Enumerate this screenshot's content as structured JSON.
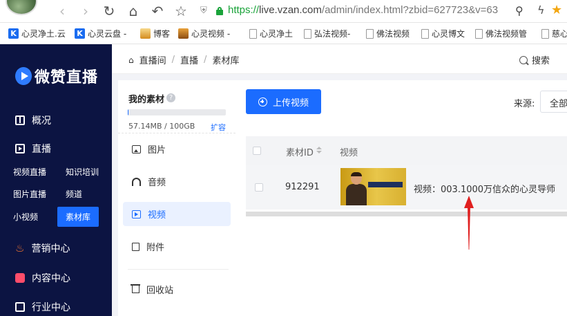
{
  "browser": {
    "url_protocol": "https://",
    "url_host": "live.vzan.com",
    "url_path": "/admin/index.html?zbid=627723&v=63"
  },
  "bookmarks": [
    {
      "label": "心灵净土.云",
      "icon": "k"
    },
    {
      "label": "心灵云盘 -",
      "icon": "k"
    },
    {
      "label": "博客",
      "icon": "img"
    },
    {
      "label": "心灵视频 -",
      "icon": "img2"
    },
    {
      "label": "心灵净土",
      "icon": "doc"
    },
    {
      "label": "弘法视频-",
      "icon": "doc"
    },
    {
      "label": "佛法视频",
      "icon": "doc"
    },
    {
      "label": "心灵博文",
      "icon": "doc"
    },
    {
      "label": "佛法视频管",
      "icon": "doc"
    },
    {
      "label": "慈心",
      "icon": "doc"
    }
  ],
  "sidebar": {
    "logo_text": "微赞直播",
    "overview": "概况",
    "live": "直播",
    "sub_items": [
      "视频直播",
      "知识培训",
      "图片直播",
      "频道",
      "小视频",
      "素材库"
    ],
    "marketing": "营销中心",
    "content": "内容中心",
    "industry": "行业中心"
  },
  "header": {
    "breadcrumb": [
      "直播间",
      "直播",
      "素材库"
    ],
    "search": "搜索"
  },
  "library": {
    "title": "我的素材",
    "usage": "57.14MB / 100GB",
    "usage_fraction": 0.0006,
    "expand": "扩容",
    "menu": [
      "图片",
      "音频",
      "视频",
      "附件"
    ],
    "recycle": "回收站"
  },
  "main": {
    "upload_button": "上传视频",
    "source_label": "来源:",
    "source_value": "全部",
    "columns": [
      "素材ID",
      "视频"
    ],
    "rows": [
      {
        "id": "912291",
        "title": "视频：003.1000万信众的心灵导师"
      }
    ]
  },
  "colors": {
    "accent": "#1b6cff",
    "sidebar": "#0c1442",
    "annotation_arrow": "#e02020"
  }
}
